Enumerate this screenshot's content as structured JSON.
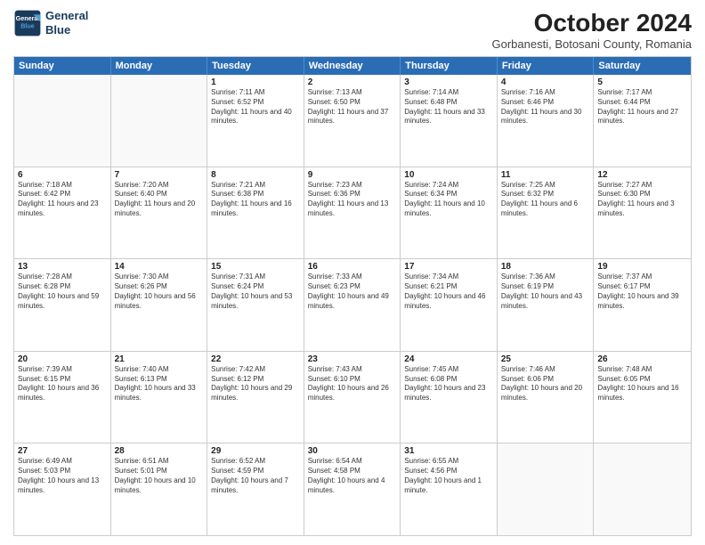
{
  "header": {
    "logo_line1": "General",
    "logo_line2": "Blue",
    "month": "October 2024",
    "location": "Gorbanesti, Botosani County, Romania"
  },
  "weekdays": [
    "Sunday",
    "Monday",
    "Tuesday",
    "Wednesday",
    "Thursday",
    "Friday",
    "Saturday"
  ],
  "weeks": [
    [
      {
        "day": null
      },
      {
        "day": null
      },
      {
        "day": "1",
        "sunrise": "7:11 AM",
        "sunset": "6:52 PM",
        "daylight": "11 hours and 40 minutes."
      },
      {
        "day": "2",
        "sunrise": "7:13 AM",
        "sunset": "6:50 PM",
        "daylight": "11 hours and 37 minutes."
      },
      {
        "day": "3",
        "sunrise": "7:14 AM",
        "sunset": "6:48 PM",
        "daylight": "11 hours and 33 minutes."
      },
      {
        "day": "4",
        "sunrise": "7:16 AM",
        "sunset": "6:46 PM",
        "daylight": "11 hours and 30 minutes."
      },
      {
        "day": "5",
        "sunrise": "7:17 AM",
        "sunset": "6:44 PM",
        "daylight": "11 hours and 27 minutes."
      }
    ],
    [
      {
        "day": "6",
        "sunrise": "7:18 AM",
        "sunset": "6:42 PM",
        "daylight": "11 hours and 23 minutes."
      },
      {
        "day": "7",
        "sunrise": "7:20 AM",
        "sunset": "6:40 PM",
        "daylight": "11 hours and 20 minutes."
      },
      {
        "day": "8",
        "sunrise": "7:21 AM",
        "sunset": "6:38 PM",
        "daylight": "11 hours and 16 minutes."
      },
      {
        "day": "9",
        "sunrise": "7:23 AM",
        "sunset": "6:36 PM",
        "daylight": "11 hours and 13 minutes."
      },
      {
        "day": "10",
        "sunrise": "7:24 AM",
        "sunset": "6:34 PM",
        "daylight": "11 hours and 10 minutes."
      },
      {
        "day": "11",
        "sunrise": "7:25 AM",
        "sunset": "6:32 PM",
        "daylight": "11 hours and 6 minutes."
      },
      {
        "day": "12",
        "sunrise": "7:27 AM",
        "sunset": "6:30 PM",
        "daylight": "11 hours and 3 minutes."
      }
    ],
    [
      {
        "day": "13",
        "sunrise": "7:28 AM",
        "sunset": "6:28 PM",
        "daylight": "10 hours and 59 minutes."
      },
      {
        "day": "14",
        "sunrise": "7:30 AM",
        "sunset": "6:26 PM",
        "daylight": "10 hours and 56 minutes."
      },
      {
        "day": "15",
        "sunrise": "7:31 AM",
        "sunset": "6:24 PM",
        "daylight": "10 hours and 53 minutes."
      },
      {
        "day": "16",
        "sunrise": "7:33 AM",
        "sunset": "6:23 PM",
        "daylight": "10 hours and 49 minutes."
      },
      {
        "day": "17",
        "sunrise": "7:34 AM",
        "sunset": "6:21 PM",
        "daylight": "10 hours and 46 minutes."
      },
      {
        "day": "18",
        "sunrise": "7:36 AM",
        "sunset": "6:19 PM",
        "daylight": "10 hours and 43 minutes."
      },
      {
        "day": "19",
        "sunrise": "7:37 AM",
        "sunset": "6:17 PM",
        "daylight": "10 hours and 39 minutes."
      }
    ],
    [
      {
        "day": "20",
        "sunrise": "7:39 AM",
        "sunset": "6:15 PM",
        "daylight": "10 hours and 36 minutes."
      },
      {
        "day": "21",
        "sunrise": "7:40 AM",
        "sunset": "6:13 PM",
        "daylight": "10 hours and 33 minutes."
      },
      {
        "day": "22",
        "sunrise": "7:42 AM",
        "sunset": "6:12 PM",
        "daylight": "10 hours and 29 minutes."
      },
      {
        "day": "23",
        "sunrise": "7:43 AM",
        "sunset": "6:10 PM",
        "daylight": "10 hours and 26 minutes."
      },
      {
        "day": "24",
        "sunrise": "7:45 AM",
        "sunset": "6:08 PM",
        "daylight": "10 hours and 23 minutes."
      },
      {
        "day": "25",
        "sunrise": "7:46 AM",
        "sunset": "6:06 PM",
        "daylight": "10 hours and 20 minutes."
      },
      {
        "day": "26",
        "sunrise": "7:48 AM",
        "sunset": "6:05 PM",
        "daylight": "10 hours and 16 minutes."
      }
    ],
    [
      {
        "day": "27",
        "sunrise": "6:49 AM",
        "sunset": "5:03 PM",
        "daylight": "10 hours and 13 minutes."
      },
      {
        "day": "28",
        "sunrise": "6:51 AM",
        "sunset": "5:01 PM",
        "daylight": "10 hours and 10 minutes."
      },
      {
        "day": "29",
        "sunrise": "6:52 AM",
        "sunset": "4:59 PM",
        "daylight": "10 hours and 7 minutes."
      },
      {
        "day": "30",
        "sunrise": "6:54 AM",
        "sunset": "4:58 PM",
        "daylight": "10 hours and 4 minutes."
      },
      {
        "day": "31",
        "sunrise": "6:55 AM",
        "sunset": "4:56 PM",
        "daylight": "10 hours and 1 minute."
      },
      {
        "day": null
      },
      {
        "day": null
      }
    ]
  ]
}
